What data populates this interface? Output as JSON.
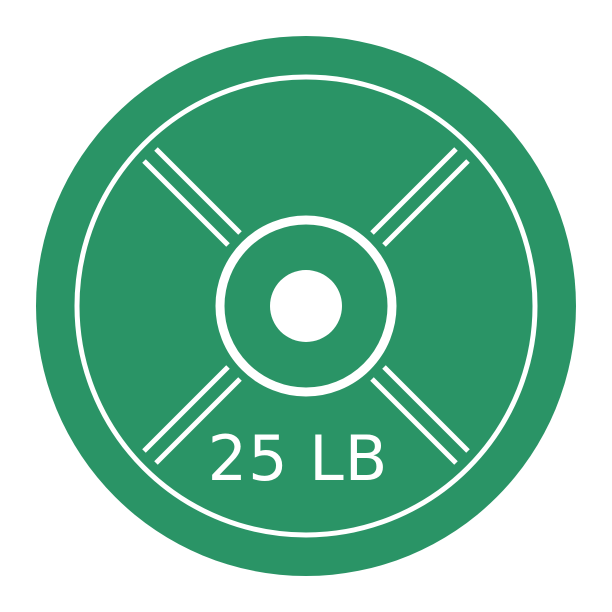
{
  "plate": {
    "label": "25 LB",
    "colors": {
      "plate": "#2a9466",
      "line": "#ffffff",
      "background": "#ffffff"
    },
    "icon": "weight-plate-icon"
  }
}
